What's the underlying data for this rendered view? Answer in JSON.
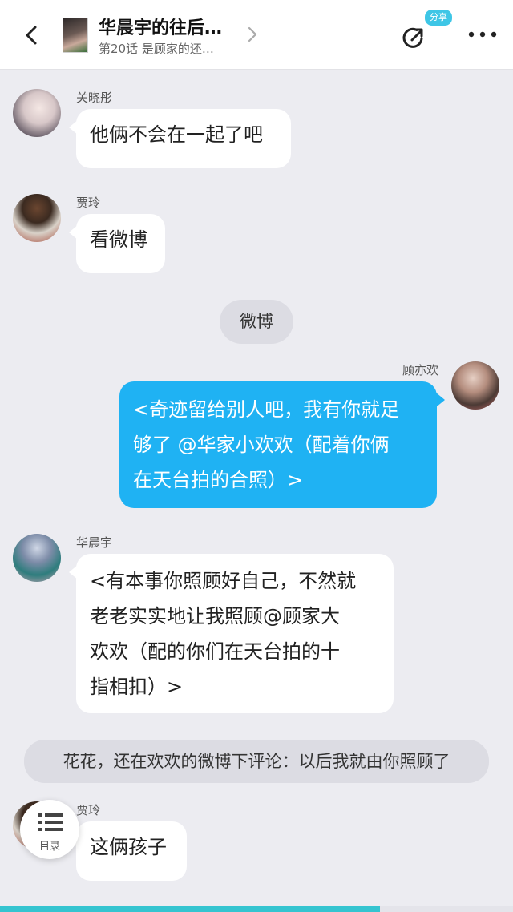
{
  "header": {
    "title": "华晨宇的往后…",
    "subtitle": "第20话 是顾家的还…",
    "share_badge": "分享"
  },
  "messages": [
    {
      "type": "left",
      "name": "关晓彤",
      "text": "他俩不会在一起了吧"
    },
    {
      "type": "left",
      "name": "贾玲",
      "text": "看微博"
    },
    {
      "type": "pill",
      "text": "微博"
    },
    {
      "type": "right",
      "name": "顾亦欢",
      "lines": [
        "<奇迹留给别人吧，我有你就足",
        "够了 @华家小欢欢（配着你俩",
        "在天台拍的合照）>"
      ]
    },
    {
      "type": "left",
      "name": "华晨宇",
      "lines": [
        "<有本事你照顾好自己，不然就",
        "老老实实地让我照顾@顾家大",
        "欢欢（配的你们在天台拍的十",
        "指相扣）>"
      ]
    },
    {
      "type": "narration",
      "text": "花花，还在欢欢的微博下评论：以后我就由你照顾了"
    },
    {
      "type": "left",
      "name": "贾玲",
      "text": "这俩孩子"
    }
  ],
  "toc": {
    "label": "目录"
  },
  "reading_progress": 0.74,
  "colors": {
    "accent": "#1fb2f3",
    "progress": "#35c4d0",
    "badge": "#3ec6e6"
  }
}
